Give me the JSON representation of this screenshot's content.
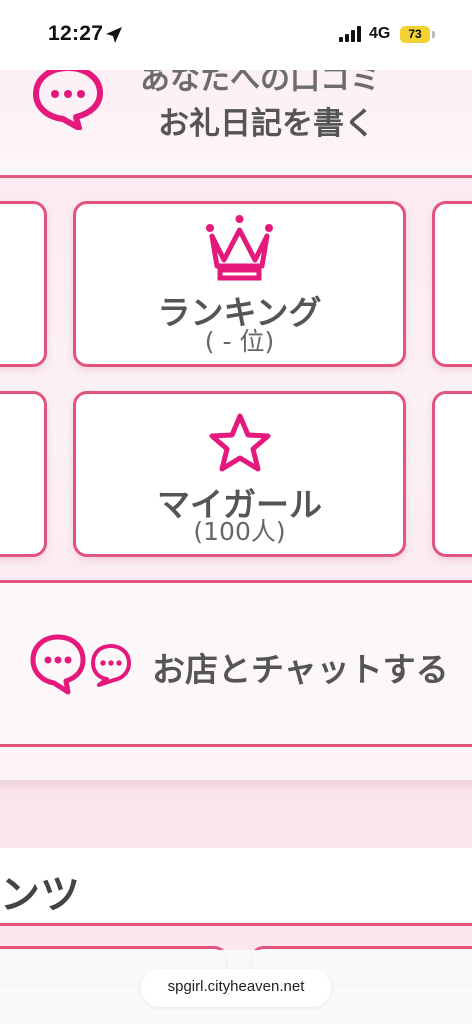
{
  "status_bar": {
    "time": "12:27",
    "network": "4G",
    "battery": "73"
  },
  "review": {
    "line1": "あなたへの口コミ",
    "line2": "お礼日記を書く"
  },
  "tiles": {
    "ranking": {
      "title": "ランキング",
      "sub": "( - 位)"
    },
    "mygirl": {
      "title": "マイガール",
      "sub": "(100人)"
    }
  },
  "chat": {
    "label": "お店とチャットする"
  },
  "content": {
    "label": "ンツ"
  },
  "browser": {
    "url": "spgirl.cityheaven.net"
  },
  "colors": {
    "accent": "#e1547b",
    "icon_pink": "#e5197c",
    "text": "#555555"
  }
}
